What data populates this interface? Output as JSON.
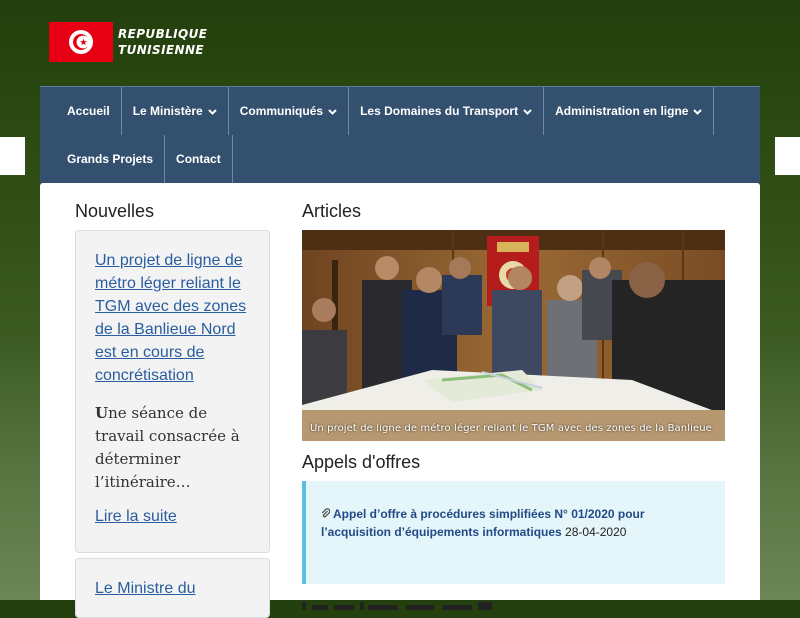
{
  "header": {
    "brand_line1": "REPUBLIQUE",
    "brand_line2": "TUNISIENNE",
    "flag_colors": {
      "red": "#e70013",
      "white": "#ffffff"
    }
  },
  "nav": {
    "row1": [
      {
        "label": "Accueil",
        "dropdown": false
      },
      {
        "label": "Le Ministère",
        "dropdown": true
      },
      {
        "label": "Communiqués",
        "dropdown": true
      },
      {
        "label": "Les Domaines du Transport",
        "dropdown": true
      },
      {
        "label": "Administration en ligne",
        "dropdown": true
      }
    ],
    "row2": [
      {
        "label": "Grands Projets",
        "dropdown": false
      },
      {
        "label": "Contact",
        "dropdown": false
      }
    ]
  },
  "news": {
    "title": "Nouvelles",
    "items": [
      {
        "headline": "Un projet de ligne de métro léger reliant le TGM avec des zones de la Banlieue Nord est en cours de concrétisation",
        "excerpt_first_letter": "U",
        "excerpt_rest": "ne séance de travail consacrée à déterminer l’itinéraire…",
        "read_more": "Lire la suite"
      },
      {
        "headline": "Le Ministre du"
      }
    ]
  },
  "articles": {
    "title": "Articles",
    "photo_caption": "Un projet de ligne de métro léger reliant le TGM avec des zones de la Banlieue"
  },
  "tenders": {
    "title": "Appels d'offres",
    "items": [
      {
        "link": "Appel d’offre à procédures simplifiées N° 01/2020 pour l’acquisition d’équipements informatiques",
        "date": "28-04-2020"
      }
    ]
  },
  "colors": {
    "nav_bg": "#34506f",
    "link": "#2a5d9f",
    "tender_bg": "#e4f6fa",
    "tender_border": "#5bc0de",
    "page_bg_top": "#233f0d",
    "page_bg_bottom": "#6b8654"
  }
}
